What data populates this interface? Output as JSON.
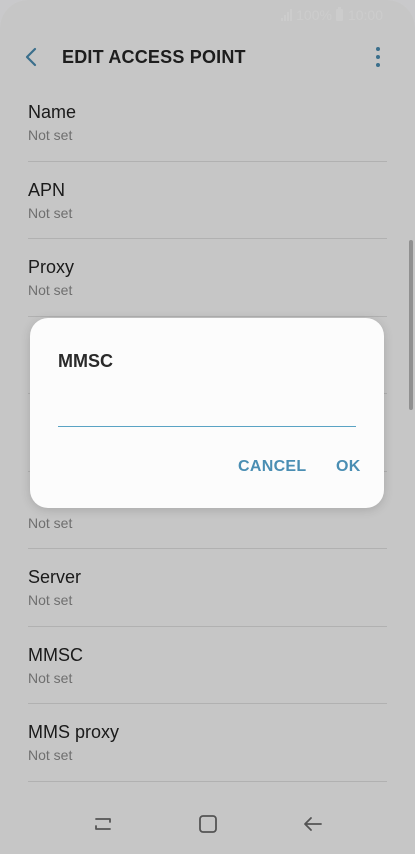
{
  "status_bar": {
    "battery": "100%",
    "time": "10:00"
  },
  "header": {
    "title": "EDIT ACCESS POINT",
    "back_icon": "chevron-left-icon",
    "more_icon": "more-vertical-icon"
  },
  "list": {
    "items": [
      {
        "label": "Name",
        "value": "Not set"
      },
      {
        "label": "APN",
        "value": "Not set"
      },
      {
        "label": "Proxy",
        "value": "Not set"
      },
      {
        "label": "",
        "value": ""
      },
      {
        "label": "",
        "value": ""
      },
      {
        "label": "",
        "value": "Not set"
      },
      {
        "label": "Server",
        "value": "Not set"
      },
      {
        "label": "MMSC",
        "value": "Not set"
      },
      {
        "label": "MMS proxy",
        "value": "Not set"
      }
    ]
  },
  "dialog": {
    "title": "MMSC",
    "input_value": "",
    "cancel_label": "CANCEL",
    "ok_label": "OK"
  },
  "colors": {
    "accent": "#4a8eb3",
    "input_underline": "#5aa3c4"
  }
}
